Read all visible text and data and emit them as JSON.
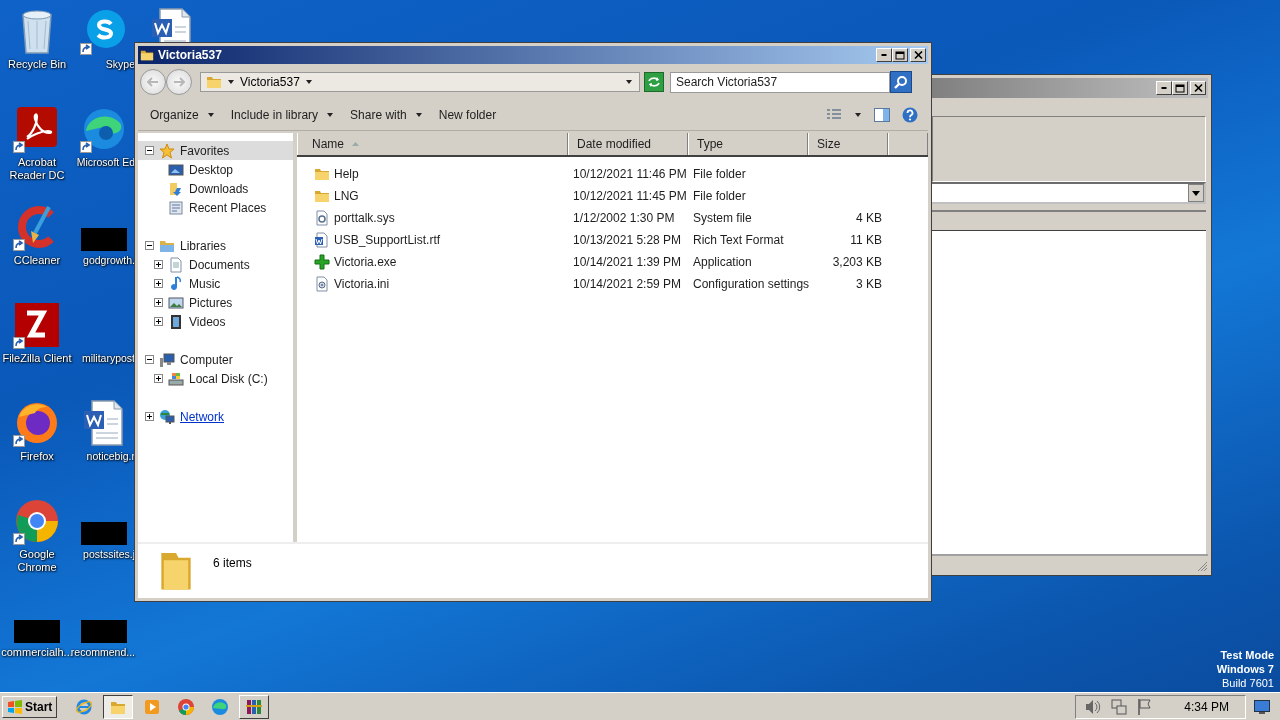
{
  "desktop": {
    "icons": [
      {
        "label": "Recycle Bin",
        "kind": "recycle",
        "shortcut": false
      },
      {
        "label": "Acrobat Reader DC",
        "kind": "acrobat",
        "shortcut": true
      },
      {
        "label": "CCleaner",
        "kind": "ccleaner",
        "shortcut": true
      },
      {
        "label": "FileZilla Client",
        "kind": "filezilla",
        "shortcut": true
      },
      {
        "label": "Firefox",
        "kind": "firefox",
        "shortcut": true
      },
      {
        "label": "Google Chrome",
        "kind": "chrome",
        "shortcut": true
      },
      {
        "label": "commercialh...",
        "kind": "redacted",
        "shortcut": false
      },
      {
        "label": "Skype",
        "kind": "skype",
        "shortcut": true
      },
      {
        "label": "Microsoft Ed",
        "kind": "edge",
        "shortcut": true
      },
      {
        "label": "godgrowth.",
        "kind": "redacted",
        "shortcut": false
      },
      {
        "label": "militarypost",
        "kind": "blank",
        "shortcut": false
      },
      {
        "label": "noticebig.r",
        "kind": "word",
        "shortcut": false
      },
      {
        "label": "postssites.j",
        "kind": "redacted",
        "shortcut": false
      },
      {
        "label": "recommend...",
        "kind": "redacted",
        "shortcut": false
      },
      {
        "kind": "word"
      }
    ]
  },
  "explorer": {
    "title": "Victoria537",
    "address": [
      "Victoria537"
    ],
    "search": {
      "placeholder": "Search Victoria537"
    },
    "commands": [
      {
        "label": "Organize",
        "dropdown": true
      },
      {
        "label": "Include in library",
        "dropdown": true
      },
      {
        "label": "Share with",
        "dropdown": true
      },
      {
        "label": "New folder",
        "dropdown": false
      }
    ],
    "nav": [
      {
        "label": "Favorites",
        "kind": "star",
        "expanded": true,
        "selected": true,
        "hovered": false,
        "children": [
          {
            "label": "Desktop",
            "kind": "desktop"
          },
          {
            "label": "Downloads",
            "kind": "downloads"
          },
          {
            "label": "Recent Places",
            "kind": "recent"
          }
        ]
      },
      {
        "label": "Libraries",
        "kind": "library",
        "expanded": true,
        "selected": false,
        "hovered": false,
        "children": [
          {
            "label": "Documents",
            "kind": "documents",
            "expanded": false
          },
          {
            "label": "Music",
            "kind": "music",
            "expanded": false
          },
          {
            "label": "Pictures",
            "kind": "pictures",
            "expanded": false
          },
          {
            "label": "Videos",
            "kind": "videos",
            "expanded": false
          }
        ]
      },
      {
        "label": "Computer",
        "kind": "computer",
        "expanded": true,
        "selected": false,
        "hovered": false,
        "children": [
          {
            "label": "Local Disk (C:)",
            "kind": "disk",
            "expanded": false
          }
        ]
      },
      {
        "label": "Network",
        "kind": "network",
        "expanded": false,
        "selected": false,
        "hovered": true
      }
    ],
    "columns": [
      {
        "label": "Name",
        "sorted": true
      },
      {
        "label": "Date modified",
        "sorted": false
      },
      {
        "label": "Type",
        "sorted": false
      },
      {
        "label": "Size",
        "sorted": false
      }
    ],
    "rows": [
      {
        "name": "Help",
        "date": "10/12/2021 11:46 PM",
        "type": "File folder",
        "kind": "folder"
      },
      {
        "name": "LNG",
        "date": "10/12/2021 11:45 PM",
        "type": "File folder",
        "kind": "folder"
      },
      {
        "name": "porttalk.sys",
        "date": "1/12/2002 1:30 PM",
        "type": "System file",
        "size": "4 KB",
        "kind": "sys"
      },
      {
        "name": "USB_SupportList.rtf",
        "date": "10/13/2021 5:28 PM",
        "type": "Rich Text Format",
        "size": "11 KB",
        "kind": "rtf"
      },
      {
        "name": "Victoria.exe",
        "date": "10/14/2021 1:39 PM",
        "type": "Application",
        "size": "3,203 KB",
        "kind": "exe"
      },
      {
        "name": "Victoria.ini",
        "date": "10/14/2021 2:59 PM",
        "type": "Configuration settings",
        "size": "3 KB",
        "kind": "ini"
      }
    ],
    "status": "6 items"
  },
  "taskbar": {
    "start": "Start",
    "apps": [
      {
        "kind": "ie",
        "active": false,
        "running": false
      },
      {
        "kind": "explorer",
        "active": true,
        "running": true
      },
      {
        "kind": "media",
        "active": false,
        "running": false
      },
      {
        "kind": "chrome",
        "active": false,
        "running": false
      },
      {
        "kind": "edge",
        "active": false,
        "running": false
      },
      {
        "kind": "winrar",
        "active": false,
        "running": true
      }
    ],
    "clock": "4:34 PM"
  },
  "os_notice": [
    {
      "text": "Test Mode",
      "bold": true
    },
    {
      "text": "Windows 7",
      "bold": true
    },
    {
      "text": "Build 7601",
      "bold": false
    }
  ]
}
